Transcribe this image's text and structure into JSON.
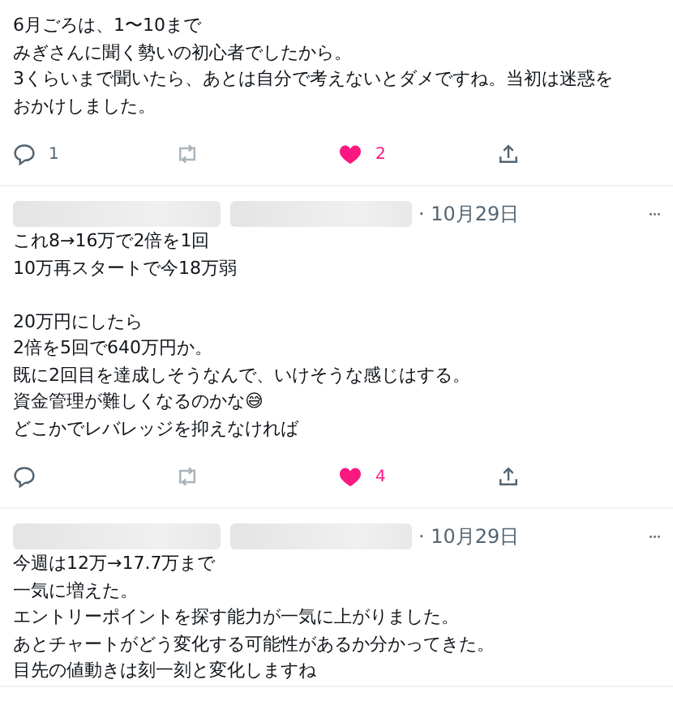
{
  "posts": [
    {
      "paragraphs": [
        [
          "6月ごろは、1〜10まで",
          "みぎさんに聞く勢いの初心者でしたから。",
          "3くらいまで聞いたら、あとは自分で考えないとダメですね。当初は迷惑を",
          "おかけしました。"
        ]
      ],
      "actions": {
        "replies": "1",
        "liked": true,
        "likes": "2"
      }
    },
    {
      "header": {
        "date": "· 10月29日",
        "more": "···"
      },
      "paragraphs": [
        [
          "これ8→16万で2倍を1回",
          "10万再スタートで今18万弱"
        ],
        [
          "20万円にしたら",
          "2倍を5回で640万円か。",
          "既に2回目を達成しそうなんで、いけそうな感じはする。",
          "資金管理が難しくなるのかな😅",
          "どこかでレバレッジを抑えなければ"
        ]
      ],
      "actions": {
        "liked": true,
        "likes": "4"
      }
    },
    {
      "header": {
        "date": "· 10月29日",
        "more": "···"
      },
      "paragraphs": [
        [
          "今週は12万→17.7万まで",
          "一気に増えた。",
          "エントリーポイントを探す能力が一気に上がりました。",
          "あとチャートがどう変化する可能性があるか分かってきた。",
          "目先の値動きは刻一刻と変化しますね"
        ]
      ]
    }
  ]
}
